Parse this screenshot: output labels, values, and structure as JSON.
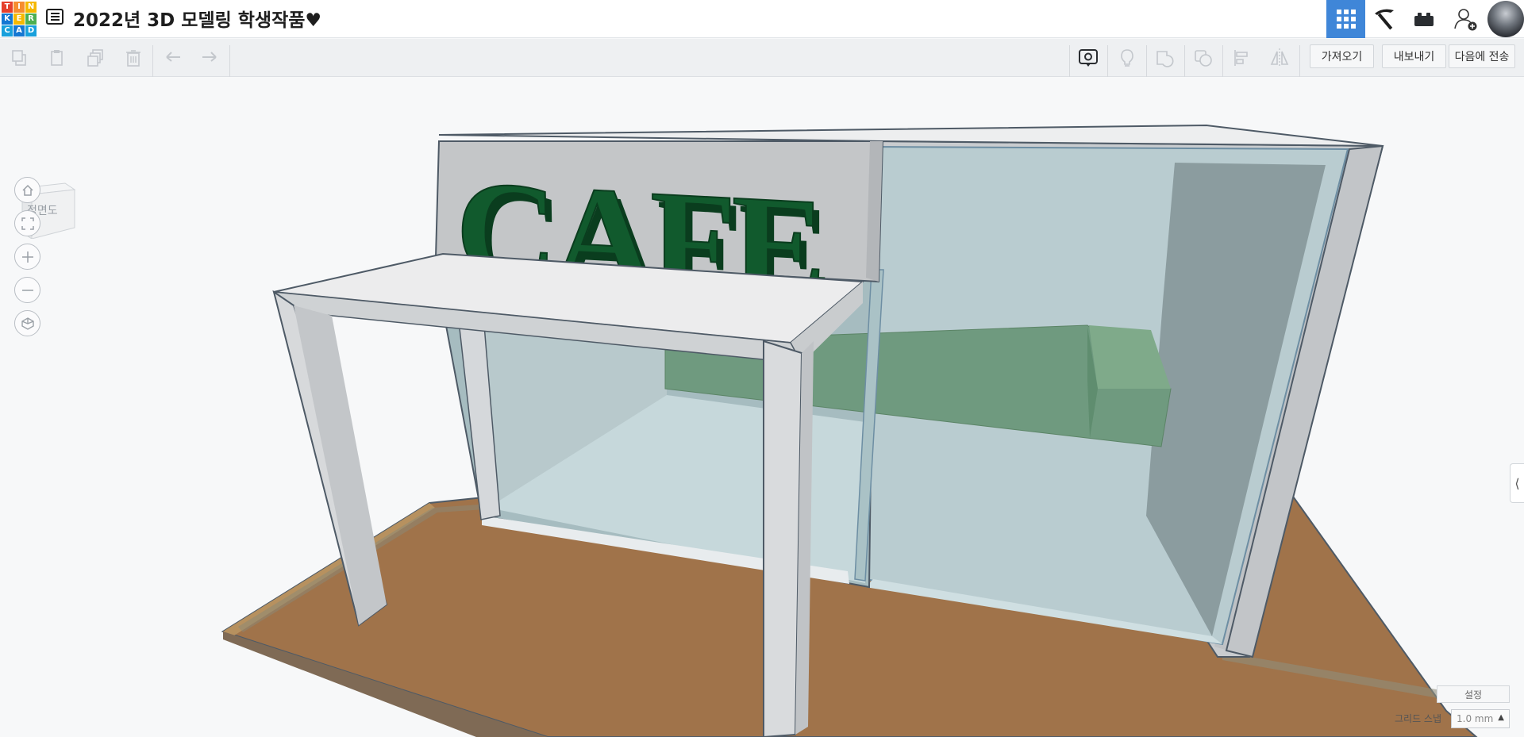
{
  "header": {
    "logo_letters": [
      "T",
      "I",
      "N",
      "K",
      "E",
      "R",
      "C",
      "A",
      "D"
    ],
    "title": "2022년 3D 모델링 학생작품♥",
    "icons": [
      "grid-view-icon",
      "pickaxe-icon",
      "brick-icon",
      "add-user-icon",
      "avatar"
    ]
  },
  "toolbar": {
    "edit_icons": [
      "copy-icon",
      "paste-icon",
      "duplicate-icon",
      "delete-icon",
      "undo-icon",
      "redo-icon"
    ],
    "view_icons": [
      "notes-icon",
      "light-icon",
      "shape-icon",
      "group-icon",
      "align-icon",
      "mirror-icon"
    ],
    "import_label": "가져오기",
    "export_label": "내보내기",
    "send_label": "다음에 전송"
  },
  "viewcube": {
    "face_label": "정면도"
  },
  "nav_buttons": [
    "home-icon",
    "fit-icon",
    "zoom-in-icon",
    "zoom-out-icon",
    "ortho-icon"
  ],
  "footer": {
    "settings_label": "설정",
    "grid_snap_label": "그리드 스냅",
    "grid_snap_value": "1.0 mm"
  },
  "model": {
    "sign_text": "CAFE"
  },
  "colors": {
    "accent": "#3f86d8",
    "sign_green": "#0f5a2c",
    "floor_brown": "#a0734a",
    "glass": "#b9ccd0"
  }
}
